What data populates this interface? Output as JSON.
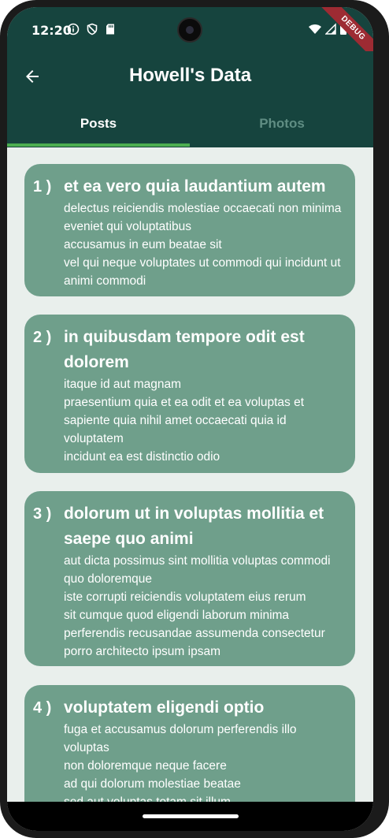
{
  "status_bar": {
    "time": "12:20",
    "left_icons": [
      "info-icon",
      "shield-icon",
      "sd-card-icon"
    ],
    "right_icons": [
      "wifi-icon",
      "signal-icon",
      "battery-icon"
    ],
    "debug_label": "DEBUG"
  },
  "app_bar": {
    "title": "Howell's Data",
    "back_icon": "arrow-left-icon"
  },
  "tabs": [
    {
      "label": "Posts",
      "active": true
    },
    {
      "label": "Photos",
      "active": false
    }
  ],
  "posts": [
    {
      "number": "1 )",
      "title": "et ea vero quia laudantium autem",
      "body": "delectus reiciendis molestiae occaecati non minima eveniet qui voluptatibus\naccusamus in eum beatae sit\nvel qui neque voluptates ut commodi qui incidunt ut animi commodi"
    },
    {
      "number": "2 )",
      "title": "in quibusdam tempore odit est dolorem",
      "body": "itaque id aut magnam\npraesentium quia et ea odit et ea voluptas et sapiente quia nihil amet occaecati quia id voluptatem\nincidunt ea est distinctio odio"
    },
    {
      "number": "3 )",
      "title": "dolorum ut in voluptas mollitia et saepe quo animi",
      "body": "aut dicta possimus sint mollitia voluptas commodi quo doloremque\niste corrupti reiciendis voluptatem eius rerum\nsit cumque quod eligendi laborum minima\nperferendis recusandae assumenda consectetur porro architecto ipsum ipsam"
    },
    {
      "number": "4 )",
      "title": "voluptatem eligendi optio",
      "body": "fuga et accusamus dolorum perferendis illo voluptas\nnon doloremque neque facere\nad qui dolorum molestiae beatae\nsed aut voluptas totam sit illum"
    }
  ],
  "colors": {
    "app_bar": "#16443e",
    "card": "#6f9f8b",
    "tab_indicator": "#4cae50",
    "inactive_tab": "#5f8d83",
    "background": "#e9efec"
  }
}
